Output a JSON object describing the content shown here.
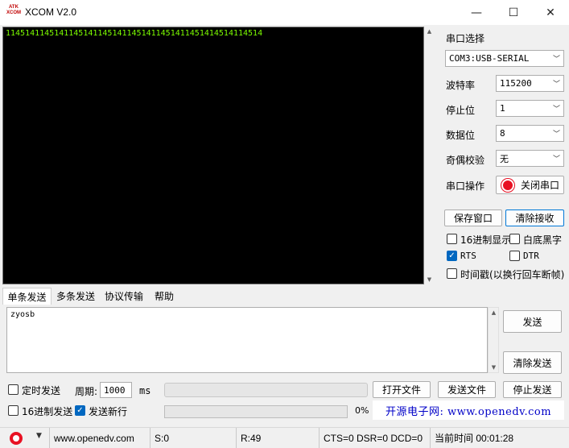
{
  "window": {
    "logo_text": "ATK XCOM",
    "title": "XCOM V2.0",
    "minimize": "—",
    "maximize": "☐",
    "close": "✕"
  },
  "terminal": {
    "received_text": "11451411451411451411451411451411451411451414514114514"
  },
  "serial": {
    "section_label": "串口选择",
    "port_value": "COM3:USB-SERIAL",
    "baud_label": "波特率",
    "baud_value": "115200",
    "stop_label": "停止位",
    "stop_value": "1",
    "data_label": "数据位",
    "data_value": "8",
    "parity_label": "奇偶校验",
    "parity_value": "无",
    "op_label": "串口操作",
    "close_port_label": "关闭串口",
    "save_window_label": "保存窗口",
    "clear_recv_label": "清除接收",
    "hex_display_label": "16进制显示",
    "hex_display_checked": false,
    "white_bg_label": "白底黑字",
    "white_bg_checked": false,
    "rts_label": "RTS",
    "rts_checked": true,
    "dtr_label": "DTR",
    "dtr_checked": false,
    "timestamp_label": "时间戳(以换行回车断帧)",
    "timestamp_checked": false
  },
  "tabs": [
    {
      "label": "单条发送",
      "active": true
    },
    {
      "label": "多条发送",
      "active": false
    },
    {
      "label": "协议传输",
      "active": false
    },
    {
      "label": "帮助",
      "active": false
    }
  ],
  "send": {
    "text": "zyosb",
    "send_label": "发送",
    "clear_send_label": "清除发送",
    "timed_send_label": "定时发送",
    "timed_send_checked": false,
    "period_label": "周期:",
    "period_value": "1000",
    "period_unit": "ms",
    "hex_send_label": "16进制发送",
    "hex_send_checked": false,
    "newline_label": "发送新行",
    "newline_checked": true,
    "open_file_label": "打开文件",
    "send_file_label": "发送文件",
    "stop_send_label": "停止发送",
    "progress_percent": 0,
    "progress_text": "0%",
    "promo_text": "开源电子网: www.openedv.com"
  },
  "status": {
    "url": "www.openedv.com",
    "sent": "S:0",
    "received": "R:49",
    "lines": "CTS=0 DSR=0 DCD=0",
    "time": "当前时间 00:01:28"
  },
  "colors": {
    "terminal_bg": "#000000",
    "terminal_text": "#7cfc00",
    "accent": "#0067c0",
    "record_red": "#e81123"
  }
}
